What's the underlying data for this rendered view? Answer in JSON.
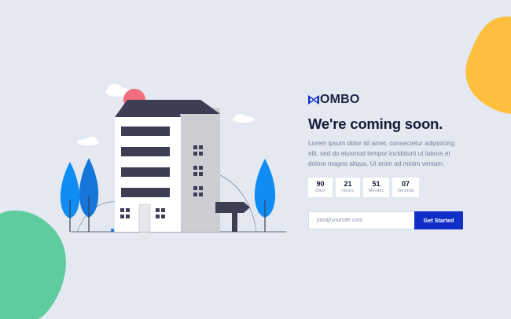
{
  "brand": {
    "name": "OMBO",
    "logo_icon": "bowtie-logo-icon",
    "accent": "#0f2fc6"
  },
  "hero": {
    "headline": "We're coming soon.",
    "description": "Lorem ipsum dolor sit amet, consectetur adipisicing elit, sed do eiusmod tempor incididunt ut labore et dolore magna aliqua. Ut enim ad minim veniam."
  },
  "countdown": [
    {
      "value": "90",
      "label": "Days"
    },
    {
      "value": "21",
      "label": "Hours"
    },
    {
      "value": "51",
      "label": "Minutes"
    },
    {
      "value": "07",
      "label": "Seconds"
    }
  ],
  "subscribe": {
    "placeholder": "you@yoursite.com",
    "button_label": "Get Started"
  },
  "colors": {
    "background": "#e4e8f1",
    "blob_yellow": "#fdbf3d",
    "blob_green": "#5fcca0",
    "tree_blue": "#0f8df5",
    "roof": "#3d3d54",
    "sun": "#f26d7d"
  }
}
